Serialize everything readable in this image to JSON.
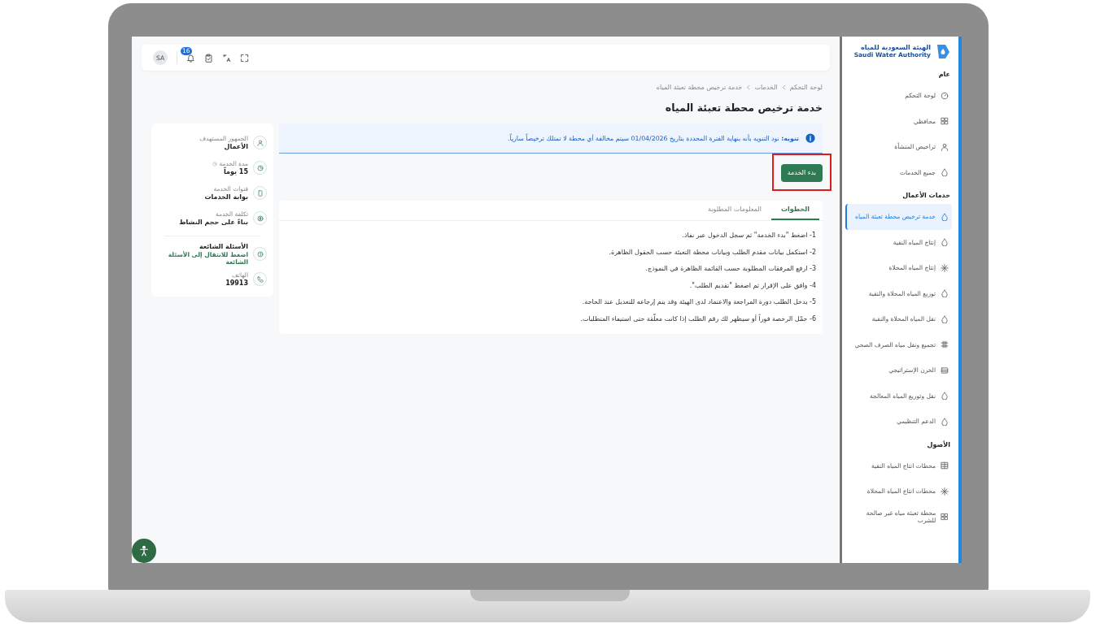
{
  "sidebar": {
    "logo": {
      "arabic": "الهيئة السعودية للمياه",
      "english": "Saudi Water Authority"
    },
    "sections": [
      {
        "title": "عام",
        "items": [
          {
            "label": "لوحة التحكم",
            "selected": false
          },
          {
            "label": "محافظي",
            "selected": false
          },
          {
            "label": "تراخيص المنشأة",
            "selected": false
          },
          {
            "label": "جميع الخدمات",
            "selected": false
          }
        ]
      },
      {
        "title": "خدمات الأعمال",
        "items": [
          {
            "label": "خدمة ترخيص محطة تعبئة المياه",
            "selected": true
          },
          {
            "label": "إنتاج المياه النقية",
            "selected": false
          },
          {
            "label": "إنتاج المياه المحلاة",
            "selected": false
          },
          {
            "label": "توزيع المياه المحلاة والنقية",
            "selected": false
          },
          {
            "label": "نقل المياه المحلاة والنقية",
            "selected": false
          },
          {
            "label": "تجميع ونقل مياه الصرف الصحي",
            "selected": false
          },
          {
            "label": "الخزن الإستراتيجي",
            "selected": false
          },
          {
            "label": "نقل وتوزيع المياه المعالجة",
            "selected": false
          },
          {
            "label": "الدعم التنظيمي",
            "selected": false
          }
        ]
      },
      {
        "title": "الأصول",
        "items": [
          {
            "label": "محطات انتاج المياه النقية",
            "selected": false
          },
          {
            "label": "محطات انتاج المياه المحلاة",
            "selected": false
          },
          {
            "label": "محطة تعبئة مياه غير صالحة للشرب",
            "selected": false
          }
        ]
      }
    ]
  },
  "topbar": {
    "avatar": "SA",
    "notification_count": "16"
  },
  "breadcrumb": [
    "لوحة التحكم",
    "الخدمات",
    "خدمة ترخيص محطة تعبئة المياه"
  ],
  "title": "خدمة ترخيص محطة تعبئة المياه",
  "notice": "**تنويه:** نود التنويه بأنه بنهاية الفترة المحددة بتاريخ 01/04/2026 سيتم مخالفة أي محطة لا تمتلك ترخيصاً سارياً.",
  "start_button": {
    "label": "بدء الخدمة",
    "highlighted": true
  },
  "tabs": [
    {
      "label": "الخطوات",
      "selected": true
    },
    {
      "label": "المعلومات المطلوبة",
      "selected": false
    }
  ],
  "steps": [
    "1- اضغط \"بدء الخدمة\" ثم سجل الدخول عبر نفاذ.",
    "2- استكمل بيانات مقدم الطلب وبيانات محطة التعبئة حسب الحقول الظاهرة.",
    "3- ارفع المرفقات المطلوبة حسب القائمة الظاهرة في النموذج.",
    "4- وافق على الإقرار ثم اضغط \"تقديم الطلب\".",
    "5- يدخل الطلب دورة المراجعة والاعتماد لدى الهيئة وقد يتم إرجاعه للتعديل عند الحاجة.",
    "6- حمّل الرخصة فوراً أو سيظهر لك رقم الطلب إذا كانت معلّقة حتى استيفاء المتطلبات."
  ],
  "info_card": {
    "items": [
      {
        "kind": "audience",
        "label": "الجمهور المستهدف",
        "value": "الأعمال"
      },
      {
        "kind": "duration",
        "label": "مدة الخدمة",
        "value": "15 يوماً"
      },
      {
        "kind": "channel",
        "label": "قنوات الخدمة",
        "value": "بوابة الخدمات"
      },
      {
        "kind": "cost",
        "label": "تكلفة الخدمة",
        "value": "بناءً على حجم النشاط"
      }
    ],
    "faq": {
      "title": "الأسئلة الشائعة",
      "link": "اضغط للانتقال إلى الأسئلة الشائعة"
    },
    "phone": {
      "label": "الهاتف",
      "value": "19913"
    }
  }
}
